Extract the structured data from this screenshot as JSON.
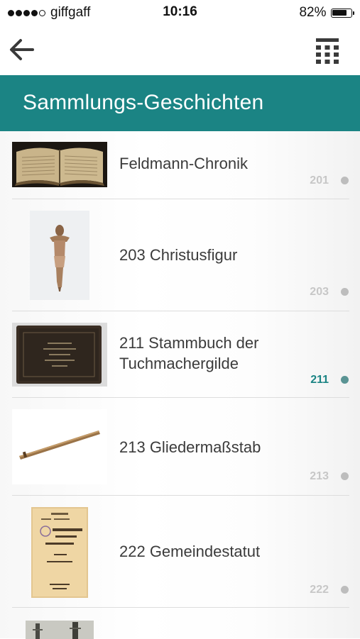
{
  "status_bar": {
    "carrier": "giffgaff",
    "time": "10:16",
    "battery_percent": "82%",
    "battery_level": 0.82,
    "signal_dots_filled": 4,
    "signal_dots_total": 5
  },
  "nav": {
    "back_icon": "back-arrow-icon",
    "keypad_icon": "keypad-icon"
  },
  "header": {
    "title": "Sammlungs-Geschichten",
    "background_color": "#1b8484"
  },
  "list": {
    "items": [
      {
        "title": "Feldmann-Chronik",
        "number": "201",
        "active": false,
        "thumbnail": "open-book"
      },
      {
        "title": "203 Christusfigur",
        "number": "203",
        "active": false,
        "thumbnail": "christ-figure"
      },
      {
        "title": "211 Stammbuch der Tuchmachergilde",
        "number": "211",
        "active": true,
        "thumbnail": "leather-book"
      },
      {
        "title": "213 Gliedermaßstab",
        "number": "213",
        "active": false,
        "thumbnail": "folding-ruler"
      },
      {
        "title": "222 Gemeindestatut",
        "number": "222",
        "active": false,
        "thumbnail": "statute-document"
      },
      {
        "title": "",
        "number": "",
        "active": false,
        "thumbnail": "photo-partial"
      }
    ]
  },
  "colors": {
    "accent": "#1b8484",
    "active_number": "#1b8484",
    "inactive_number": "#c7c7c7"
  }
}
